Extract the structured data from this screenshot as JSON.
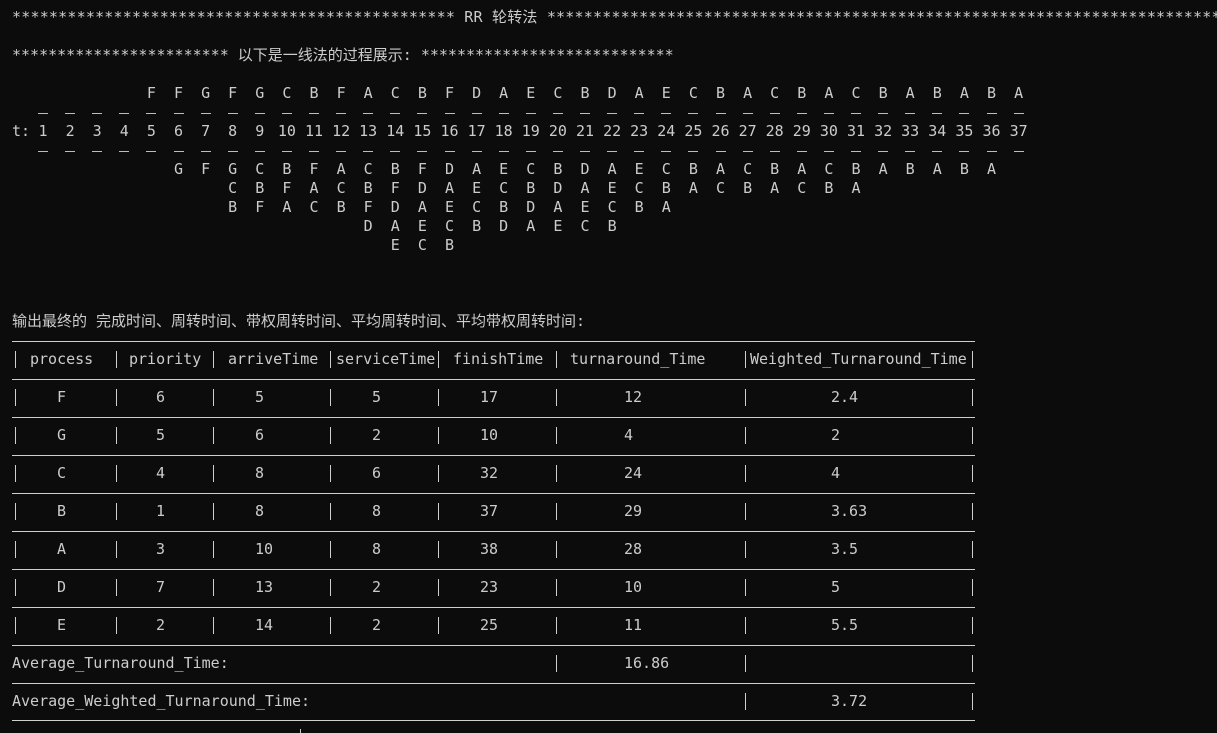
{
  "banner": "************************************************ RR 轮转法 *************************************************************************",
  "subtitle": "************************ 以下是一线法的过程展示: ****************************",
  "timeline": {
    "label": "t:",
    "times": [
      "1",
      "2",
      "3",
      "4",
      "5",
      "6",
      "7",
      "8",
      "9",
      "10",
      "11",
      "12",
      "13",
      "14",
      "15",
      "16",
      "17",
      "18",
      "19",
      "20",
      "21",
      "22",
      "23",
      "24",
      "25",
      "26",
      "27",
      "28",
      "29",
      "30",
      "31",
      "32",
      "33",
      "34",
      "35",
      "36",
      "37"
    ],
    "running": {
      "5": "F",
      "6": "F",
      "7": "G",
      "8": "F",
      "9": "G",
      "10": "C",
      "11": "B",
      "12": "F",
      "13": "A",
      "14": "C",
      "15": "B",
      "16": "F",
      "17": "D",
      "18": "A",
      "19": "E",
      "20": "C",
      "21": "B",
      "22": "D",
      "23": "A",
      "24": "E",
      "25": "C",
      "26": "B",
      "27": "A",
      "28": "C",
      "29": "B",
      "30": "A",
      "31": "C",
      "32": "B",
      "33": "A",
      "34": "B",
      "35": "A",
      "36": "B",
      "37": "A"
    },
    "queues": [
      {
        "start": 6,
        "letters": [
          "G",
          "F",
          "G",
          "C",
          "B",
          "F",
          "A",
          "C",
          "B",
          "F",
          "D",
          "A",
          "E",
          "C",
          "B",
          "D",
          "A",
          "E",
          "C",
          "B",
          "A",
          "C",
          "B",
          "A",
          "C",
          "B",
          "A",
          "B",
          "A",
          "B",
          "A"
        ]
      },
      {
        "start": 8,
        "letters": [
          "C",
          "B",
          "F",
          "A",
          "C",
          "B",
          "F",
          "D",
          "A",
          "E",
          "C",
          "B",
          "D",
          "A",
          "E",
          "C",
          "B",
          "A",
          "C",
          "B",
          "A",
          "C",
          "B",
          "A"
        ]
      },
      {
        "start": 8,
        "letters": [
          "B",
          "F",
          "A",
          "C",
          "B",
          "F",
          "D",
          "A",
          "E",
          "C",
          "B",
          "D",
          "A",
          "E",
          "C",
          "B",
          "A"
        ]
      },
      {
        "start": 13,
        "letters": [
          "D",
          "A",
          "E",
          "C",
          "B",
          "D",
          "A",
          "E",
          "C",
          "B"
        ]
      },
      {
        "start": 14,
        "letters": [
          "E",
          "C",
          "B"
        ]
      }
    ]
  },
  "output_title": "输出最终的 完成时间、周转时间、带权周转时间、平均周转时间、平均带权周转时间:",
  "table": {
    "headers": [
      "process",
      "priority",
      "arriveTime",
      "serviceTime",
      "finishTime",
      "turnaround_Time",
      "Weighted_Turnaround_Time"
    ],
    "rows": [
      [
        "F",
        "6",
        "5",
        "5",
        "17",
        "12",
        "2.4"
      ],
      [
        "G",
        "5",
        "6",
        "2",
        "10",
        "4",
        "2"
      ],
      [
        "C",
        "4",
        "8",
        "6",
        "32",
        "24",
        "4"
      ],
      [
        "B",
        "1",
        "8",
        "8",
        "37",
        "29",
        "3.63"
      ],
      [
        "A",
        "3",
        "10",
        "8",
        "38",
        "28",
        "3.5"
      ],
      [
        "D",
        "7",
        "13",
        "2",
        "23",
        "10",
        "5"
      ],
      [
        "E",
        "2",
        "14",
        "2",
        "25",
        "11",
        "5.5"
      ]
    ],
    "avg_turnaround_label": "Average_Turnaround_Time:",
    "avg_turnaround_value": "16.86",
    "avg_weighted_label": "Average_Weighted_Turnaround_Time:",
    "avg_weighted_value": "3.72"
  }
}
